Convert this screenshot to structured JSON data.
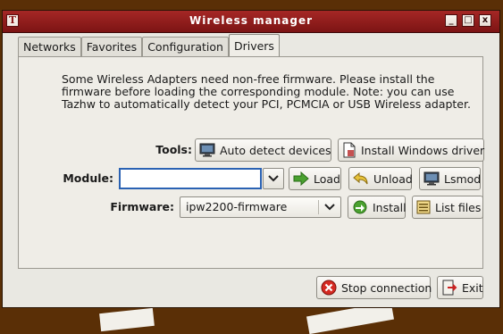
{
  "window": {
    "title": "Wireless manager"
  },
  "title_buttons": {
    "minimize": "_",
    "maximize": "□",
    "close": "x"
  },
  "tabs": [
    {
      "label": "Networks",
      "active": false
    },
    {
      "label": "Favorites",
      "active": false
    },
    {
      "label": "Configuration",
      "active": false
    },
    {
      "label": "Drivers",
      "active": true
    }
  ],
  "drivers": {
    "info_text": "Some Wireless Adapters need non-free firmware. Please install the firmware before loading the corresponding module. Note: you can use Tazhw to automatically detect your PCI, PCMCIA or USB Wireless adapter.",
    "tools_label": "Tools:",
    "auto_detect_label": "Auto detect devices",
    "install_windows_label": "Install Windows driver",
    "module_label": "Module:",
    "module_value": "",
    "load_label": "Load",
    "unload_label": "Unload",
    "lsmod_label": "Lsmod",
    "firmware_label": "Firmware:",
    "firmware_selected": "ipw2200-firmware",
    "install_label": "Install",
    "list_files_label": "List files"
  },
  "footer": {
    "stop_label": "Stop connection",
    "exit_label": "Exit"
  },
  "icons": {
    "app": "app-icon",
    "auto_detect": "monitor-icon",
    "install_windows": "document-icon",
    "load": "arrow-right-icon",
    "unload": "undo-icon",
    "lsmod": "monitor-icon",
    "install": "install-arrow-icon",
    "list_files": "list-icon",
    "stop": "stop-icon",
    "exit": "exit-icon"
  },
  "colors": {
    "titlebar": "#9a1f1f",
    "desktop": "#5a2f06",
    "focus": "#2a62b3"
  }
}
